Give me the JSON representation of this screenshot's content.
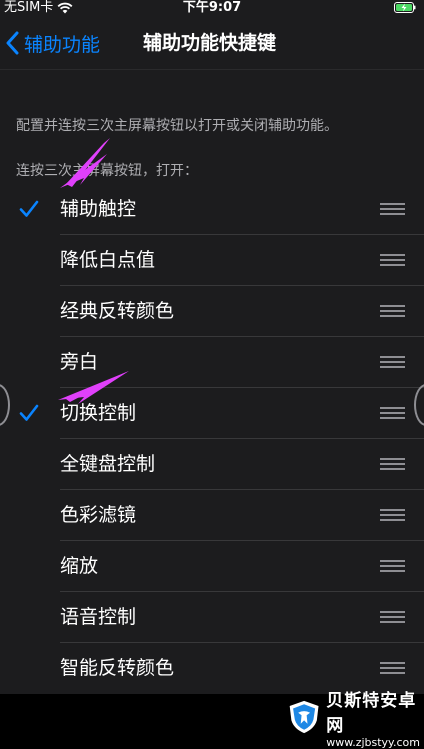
{
  "status_bar": {
    "carrier": "无SIM卡",
    "time": "下午9:07"
  },
  "nav": {
    "back_label": "辅助功能",
    "title": "辅助功能快捷键"
  },
  "description": "配置并连按三次主屏幕按钮以打开或关闭辅助功能。",
  "group_header": "连按三次主屏幕按钮，打开：",
  "items": [
    {
      "label": "辅助触控",
      "checked": true
    },
    {
      "label": "降低白点值",
      "checked": false
    },
    {
      "label": "经典反转颜色",
      "checked": false
    },
    {
      "label": "旁白",
      "checked": false
    },
    {
      "label": "切换控制",
      "checked": true
    },
    {
      "label": "全键盘控制",
      "checked": false
    },
    {
      "label": "色彩滤镜",
      "checked": false
    },
    {
      "label": "缩放",
      "checked": false
    },
    {
      "label": "语音控制",
      "checked": false
    },
    {
      "label": "智能反转颜色",
      "checked": false
    }
  ],
  "colors": {
    "accent": "#0a84ff",
    "annotation_arrow": "#e040fb"
  },
  "watermark": {
    "name": "贝斯特安卓网",
    "url": "www.zjbstyy.com"
  }
}
